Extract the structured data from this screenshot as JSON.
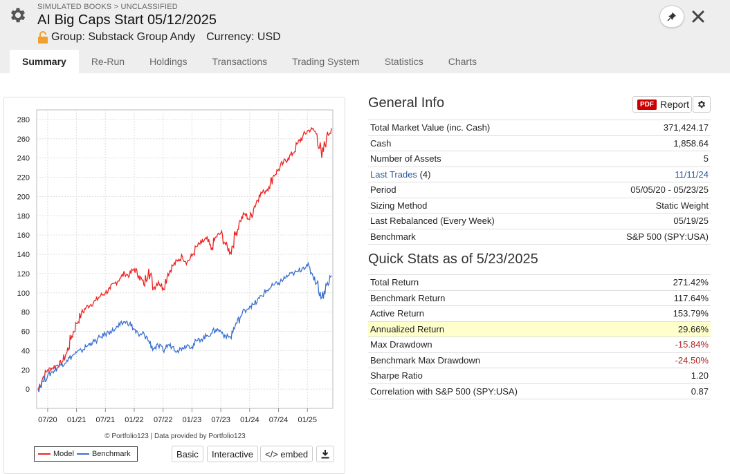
{
  "header": {
    "breadcrumb": "SIMULATED BOOKS > UNCLASSIFIED",
    "title": "AI Big Caps Start 05/12/2025",
    "group": "Group: Substack Group Andy",
    "currency": "Currency: USD"
  },
  "tabs": [
    "Summary",
    "Re-Run",
    "Holdings",
    "Transactions",
    "Trading System",
    "Statistics",
    "Charts"
  ],
  "active_tab": "Summary",
  "general_info": {
    "title": "General Info",
    "report_label": "Report",
    "pdf_badge": "PDF",
    "rows": [
      {
        "label": "Total Market Value (inc. Cash)",
        "value": "371,424.17"
      },
      {
        "label": "Cash",
        "value": "1,858.64"
      },
      {
        "label": "Number of Assets",
        "value": "5"
      },
      {
        "label": "Last Trades",
        "count": "(4)",
        "value": "11/11/24"
      },
      {
        "label": "Period",
        "value": "05/05/20 - 05/23/25"
      },
      {
        "label": "Sizing Method",
        "value": "Static Weight"
      },
      {
        "label": "Last Rebalanced (Every Week)",
        "value": "05/19/25"
      },
      {
        "label": "Benchmark",
        "value": "S&P 500 (SPY:USA)"
      }
    ]
  },
  "quick_stats": {
    "title": "Quick Stats as of 5/23/2025",
    "rows": [
      {
        "label": "Total Return",
        "value": "271.42%"
      },
      {
        "label": "Benchmark Return",
        "value": "117.64%"
      },
      {
        "label": "Active Return",
        "value": "153.79%"
      },
      {
        "label": "Annualized Return",
        "value": "29.66%"
      },
      {
        "label": "Max Drawdown",
        "value": "-15.84%"
      },
      {
        "label": "Benchmark Max Drawdown",
        "value": "-24.50%"
      },
      {
        "label": "Sharpe Ratio",
        "value": "1.20"
      },
      {
        "label": "Correlation with S&P 500 (SPY:USA)",
        "value": "0.87"
      }
    ]
  },
  "chart_footer": {
    "credit": "© Portfolio123 | Data provided by Portfolio123",
    "buttons": {
      "basic": "Basic",
      "interactive": "Interactive",
      "embed": "</> embed"
    }
  },
  "colors": {
    "model": "#ee2222",
    "benchmark": "#3b6fd0",
    "negative": "#b22222",
    "link": "#2a5a9a",
    "highlight": "#ffffcc"
  },
  "icons": {
    "settings": "gear-icon",
    "lock": "lock-icon",
    "pin": "pin-icon",
    "close": "close-icon",
    "download": "download-icon"
  },
  "chart_data": {
    "type": "line",
    "x_tick_labels": [
      "07/20",
      "01/21",
      "07/21",
      "01/22",
      "07/22",
      "01/23",
      "07/23",
      "01/24",
      "07/24",
      "01/25"
    ],
    "x_ticks_month_index": [
      2,
      8,
      14,
      20,
      26,
      32,
      38,
      44,
      50,
      56
    ],
    "y_ticks": [
      0,
      20,
      40,
      60,
      80,
      100,
      120,
      140,
      160,
      180,
      200,
      220,
      240,
      260,
      280
    ],
    "ylim": [
      -20,
      290
    ],
    "grid": true,
    "legend_position": "bottom-left",
    "x_note": "monthly points from 05/2020 (index 0) to 05/2025",
    "series": [
      {
        "name": "Model",
        "values": [
          0,
          12,
          20,
          22,
          25,
          28,
          38,
          55,
          68,
          78,
          85,
          88,
          92,
          97,
          100,
          104,
          110,
          115,
          120,
          118,
          125,
          118,
          108,
          125,
          105,
          112,
          105,
          120,
          128,
          133,
          138,
          132,
          138,
          148,
          152,
          156,
          145,
          158,
          162,
          150,
          142,
          160,
          175,
          182,
          176,
          190,
          202,
          205,
          210,
          222,
          228,
          235,
          240,
          245,
          255,
          262,
          268,
          270,
          265,
          240,
          262,
          271
        ]
      },
      {
        "name": "Benchmark",
        "values": [
          0,
          8,
          14,
          18,
          22,
          26,
          30,
          34,
          38,
          40,
          44,
          48,
          50,
          54,
          57,
          60,
          62,
          66,
          70,
          68,
          62,
          55,
          58,
          50,
          42,
          45,
          40,
          46,
          44,
          40,
          43,
          46,
          44,
          50,
          52,
          55,
          58,
          62,
          60,
          55,
          54,
          66,
          74,
          82,
          86,
          88,
          94,
          100,
          104,
          108,
          110,
          114,
          118,
          120,
          122,
          126,
          128,
          120,
          110,
          95,
          108,
          118
        ]
      }
    ]
  }
}
